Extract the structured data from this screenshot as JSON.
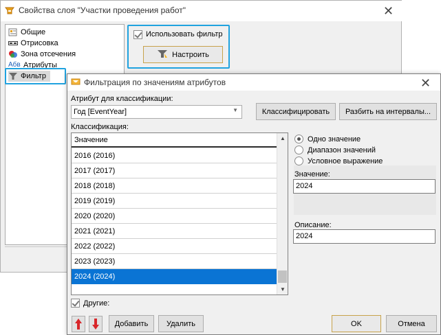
{
  "layer_window": {
    "title": "Свойства слоя \"Участки проведения работ\"",
    "tree_items": [
      {
        "label": "Общие",
        "icon": "general-icon"
      },
      {
        "label": "Отрисовка",
        "icon": "rendering-icon"
      },
      {
        "label": "Зона отсечения",
        "icon": "clip-zone-icon"
      },
      {
        "label": "Атрибуты",
        "icon": "attributes-icon",
        "icon_text": "Абв"
      },
      {
        "label": "Фильтр",
        "icon": "filter-icon",
        "selected": true
      }
    ],
    "use_filter_label": "Использовать фильтр",
    "use_filter_checked": true,
    "configure_button": "Настроить"
  },
  "filter_dialog": {
    "title": "Фильтрация по значениям атрибутов",
    "attribute_label": "Атрибут для классификации:",
    "attribute_value": "Год [EventYear]",
    "classify_button": "Классифицировать",
    "split_button": "Разбить на интервалы...",
    "classification_label": "Классификация:",
    "column_header": "Значение",
    "rows": [
      "2016 (2016)",
      "2017 (2017)",
      "2018 (2018)",
      "2019 (2019)",
      "2020 (2020)",
      "2021 (2021)",
      "2022 (2022)",
      "2023 (2023)",
      "2024 (2024)"
    ],
    "selected_row": "2024 (2024)",
    "radio_options": [
      {
        "label": "Одно значение",
        "checked": true
      },
      {
        "label": "Диапазон значений",
        "checked": false
      },
      {
        "label": "Условное выражение",
        "checked": false
      }
    ],
    "value_label": "Значение:",
    "value": "2024",
    "description_label": "Описание:",
    "description": "2024",
    "others_label": "Другие:",
    "others_checked": true,
    "add_button": "Добавить",
    "delete_button": "Удалить",
    "ok_button": "OK",
    "cancel_button": "Отмена"
  },
  "colors": {
    "accent": "#1fa2df",
    "selection": "#0a74d4",
    "arrow_red": "#d8262a"
  }
}
